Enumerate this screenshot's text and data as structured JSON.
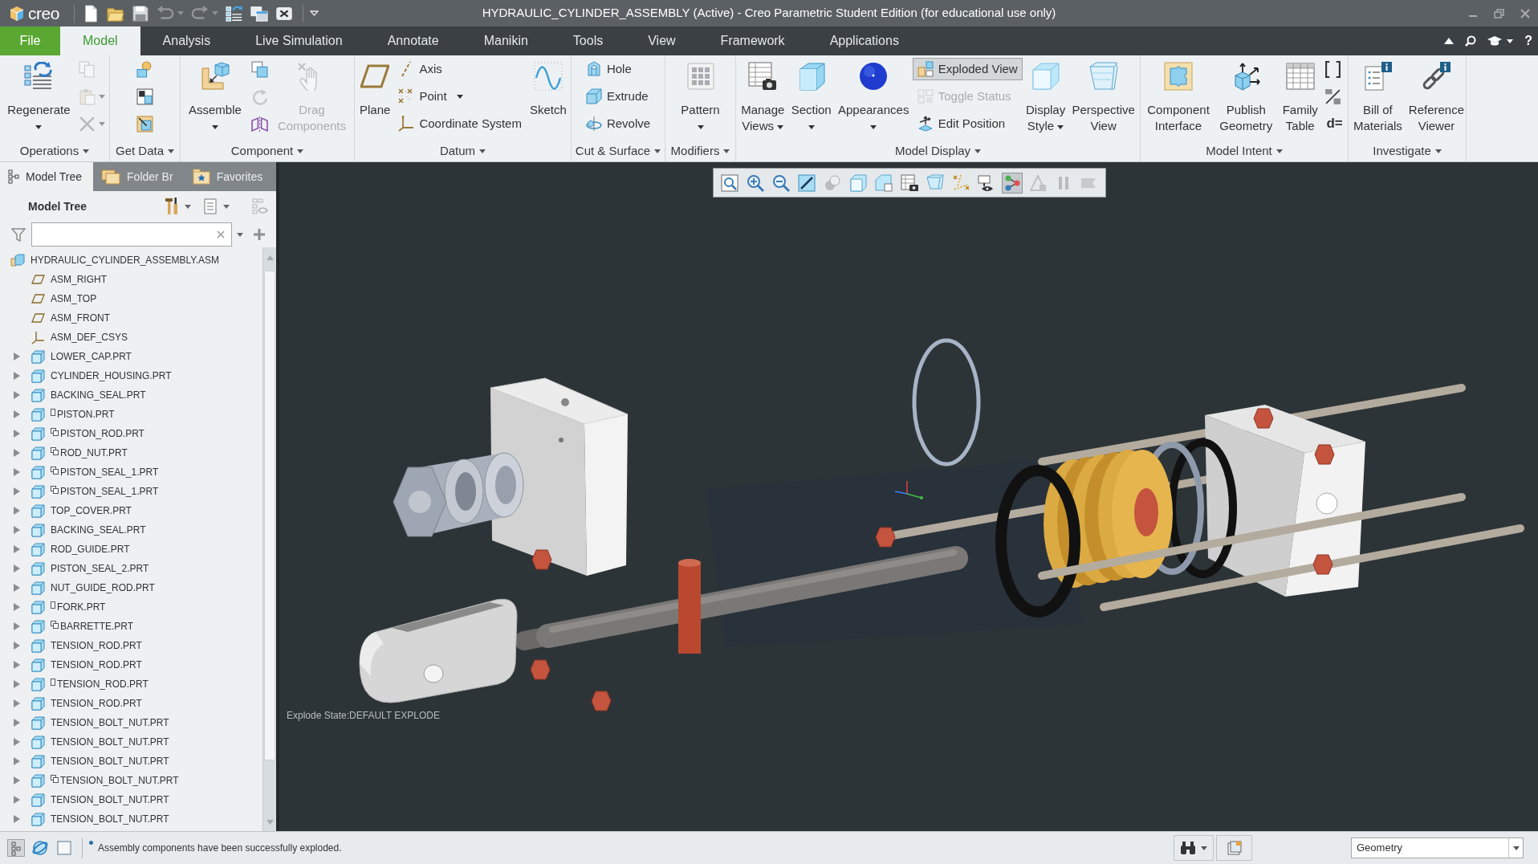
{
  "title_bar": {
    "logo": "creo",
    "quick_access": [
      {
        "disabled": false,
        "menu": false
      },
      {
        "disabled": false,
        "menu": false
      },
      {
        "disabled": false,
        "menu": false
      },
      {
        "disabled": true,
        "menu": true
      },
      {
        "disabled": true,
        "menu": true
      },
      {
        "disabled": false,
        "menu": false
      },
      {
        "disabled": false,
        "menu": false
      },
      {
        "disabled": false,
        "menu": false
      }
    ],
    "title": "HYDRAULIC_CYLINDER_ASSEMBLY (Active) - Creo Parametric Student Edition (for educational use only)"
  },
  "tab_bar": {
    "tabs": [
      {
        "label": "File",
        "kind": "file",
        "selected": false
      },
      {
        "label": "Model",
        "kind": "tab",
        "selected": true
      },
      {
        "label": "Analysis",
        "kind": "tab",
        "selected": false
      },
      {
        "label": "Live Simulation",
        "kind": "tab",
        "selected": false
      },
      {
        "label": "Annotate",
        "kind": "tab",
        "selected": false
      },
      {
        "label": "Manikin",
        "kind": "tab",
        "selected": false
      },
      {
        "label": "Tools",
        "kind": "tab",
        "selected": false
      },
      {
        "label": "View",
        "kind": "tab",
        "selected": false
      },
      {
        "label": "Framework",
        "kind": "tab",
        "selected": false
      },
      {
        "label": "Applications",
        "kind": "tab",
        "selected": false
      }
    ],
    "help": "?"
  },
  "ribbon": {
    "groups": [
      {
        "label": "Operations",
        "menu": true,
        "items": [
          {
            "kind": "large",
            "label": "Regenerate",
            "menu": true,
            "disabled": false,
            "selected": false
          },
          {
            "kind": "icon",
            "menu": false,
            "disabled": true,
            "selected": false
          },
          {
            "kind": "icon",
            "menu": true,
            "disabled": true,
            "selected": false
          },
          {
            "kind": "icon",
            "menu": true,
            "disabled": true,
            "selected": false
          }
        ]
      },
      {
        "label": "Get Data",
        "menu": true,
        "items": [
          {
            "kind": "icon",
            "menu": false,
            "disabled": false,
            "selected": false
          },
          {
            "kind": "icon",
            "menu": false,
            "disabled": false,
            "selected": false
          },
          {
            "kind": "icon",
            "menu": false,
            "disabled": false,
            "selected": false
          }
        ]
      },
      {
        "label": "Component",
        "menu": true,
        "items": [
          {
            "kind": "large",
            "label": "Assemble",
            "menu": true,
            "disabled": false,
            "selected": false
          },
          {
            "kind": "icon",
            "menu": false,
            "disabled": false,
            "selected": false
          },
          {
            "kind": "icon",
            "menu": false,
            "disabled": true,
            "selected": false
          },
          {
            "kind": "icon",
            "menu": false,
            "disabled": false,
            "selected": false
          },
          {
            "kind": "large",
            "label": "Drag Components",
            "menu": false,
            "disabled": true,
            "selected": false
          }
        ]
      },
      {
        "label": "Datum",
        "menu": true,
        "items": [
          {
            "kind": "large",
            "label": "Plane",
            "menu": false,
            "disabled": false,
            "selected": false
          },
          {
            "kind": "small",
            "label": "Axis",
            "menu": false,
            "disabled": false,
            "selected": false
          },
          {
            "kind": "small",
            "label": "Point",
            "menu": true,
            "disabled": false,
            "selected": false
          },
          {
            "kind": "small",
            "label": "Coordinate System",
            "menu": false,
            "disabled": false,
            "selected": false
          },
          {
            "kind": "large",
            "label": "Sketch",
            "menu": false,
            "disabled": false,
            "selected": false
          }
        ]
      },
      {
        "label": "Cut & Surface",
        "menu": true,
        "items": [
          {
            "kind": "small",
            "label": "Hole",
            "menu": false,
            "disabled": false,
            "selected": false
          },
          {
            "kind": "small",
            "label": "Extrude",
            "menu": false,
            "disabled": false,
            "selected": false
          },
          {
            "kind": "small",
            "label": "Revolve",
            "menu": false,
            "disabled": false,
            "selected": false
          }
        ]
      },
      {
        "label": "Modifiers",
        "menu": true,
        "items": [
          {
            "kind": "large",
            "label": "Pattern",
            "menu": true,
            "disabled": false,
            "selected": false
          }
        ]
      },
      {
        "label": "Model Display",
        "menu": true,
        "items": [
          {
            "kind": "large",
            "label": "Manage Views",
            "menu": true,
            "disabled": false,
            "selected": false
          },
          {
            "kind": "large",
            "label": "Section",
            "menu": true,
            "disabled": false,
            "selected": false
          },
          {
            "kind": "large",
            "label": "Appearances",
            "menu": true,
            "disabled": false,
            "selected": false
          },
          {
            "kind": "small",
            "label": "Exploded View",
            "menu": false,
            "disabled": false,
            "selected": true
          },
          {
            "kind": "small",
            "label": "Toggle Status",
            "menu": false,
            "disabled": true,
            "selected": false
          },
          {
            "kind": "small",
            "label": "Edit Position",
            "menu": false,
            "disabled": false,
            "selected": false
          },
          {
            "kind": "large",
            "label": "Display Style",
            "menu": true,
            "disabled": false,
            "selected": false
          },
          {
            "kind": "large",
            "label": "Perspective View",
            "menu": false,
            "disabled": false,
            "selected": false
          }
        ]
      },
      {
        "label": "Model Intent",
        "menu": true,
        "items": [
          {
            "kind": "large",
            "label": "Component Interface",
            "menu": false,
            "disabled": false,
            "selected": false
          },
          {
            "kind": "large",
            "label": "Publish Geometry",
            "menu": false,
            "disabled": false,
            "selected": false
          },
          {
            "kind": "large",
            "label": "Family Table",
            "menu": false,
            "disabled": false,
            "selected": false
          },
          {
            "kind": "icon",
            "menu": false,
            "disabled": false,
            "selected": false
          },
          {
            "kind": "icon",
            "menu": false,
            "disabled": false,
            "selected": false
          },
          {
            "kind": "glyph",
            "label": "d=",
            "menu": false,
            "disabled": false,
            "selected": false
          }
        ]
      },
      {
        "label": "Investigate",
        "menu": true,
        "items": [
          {
            "kind": "large",
            "label": "Bill of Materials",
            "menu": false,
            "disabled": false,
            "selected": false
          },
          {
            "kind": "large",
            "label": "Reference Viewer",
            "menu": false,
            "disabled": false,
            "selected": false
          }
        ]
      }
    ]
  },
  "left_panel": {
    "tabs": [
      {
        "label": "Model Tree",
        "selected": true
      },
      {
        "label": "Folder Br",
        "selected": false
      },
      {
        "label": "Favorites",
        "selected": false
      }
    ],
    "header": "Model Tree",
    "tree": {
      "label": "HYDRAULIC_CYLINDER_ASSEMBLY.ASM",
      "kind": "assembly",
      "children": [
        {
          "label": "ASM_RIGHT",
          "kind": "plane"
        },
        {
          "label": "ASM_TOP",
          "kind": "plane"
        },
        {
          "label": "ASM_FRONT",
          "kind": "plane"
        },
        {
          "label": "ASM_DEF_CSYS",
          "kind": "csys"
        },
        {
          "label": "LOWER_CAP.PRT",
          "kind": "part",
          "expanded": false
        },
        {
          "label": "CYLINDER_HOUSING.PRT",
          "kind": "part",
          "expanded": false
        },
        {
          "label": "BACKING_SEAL.PRT",
          "kind": "part",
          "expanded": false
        },
        {
          "label": "PISTON.PRT",
          "kind": "part",
          "expanded": false,
          "badge": {
            "kind": "box"
          }
        },
        {
          "label": "PISTON_ROD.PRT",
          "kind": "part",
          "expanded": false,
          "badge": {
            "kind": "stack"
          }
        },
        {
          "label": "ROD_NUT.PRT",
          "kind": "part",
          "expanded": false,
          "badge": {
            "kind": "stack"
          }
        },
        {
          "label": "PISTON_SEAL_1.PRT",
          "kind": "part",
          "expanded": false,
          "badge": {
            "kind": "stack"
          }
        },
        {
          "label": "PISTON_SEAL_1.PRT",
          "kind": "part",
          "expanded": false,
          "badge": {
            "kind": "stack"
          }
        },
        {
          "label": "TOP_COVER.PRT",
          "kind": "part",
          "expanded": false
        },
        {
          "label": "BACKING_SEAL.PRT",
          "kind": "part",
          "expanded": false
        },
        {
          "label": "ROD_GUIDE.PRT",
          "kind": "part",
          "expanded": false
        },
        {
          "label": "PISTON_SEAL_2.PRT",
          "kind": "part",
          "expanded": false
        },
        {
          "label": "NUT_GUIDE_ROD.PRT",
          "kind": "part",
          "expanded": false
        },
        {
          "label": "FORK.PRT",
          "kind": "part",
          "expanded": false,
          "badge": {
            "kind": "box"
          }
        },
        {
          "label": "BARRETTE.PRT",
          "kind": "part",
          "expanded": false,
          "badge": {
            "kind": "stack"
          }
        },
        {
          "label": "TENSION_ROD.PRT",
          "kind": "part",
          "expanded": false
        },
        {
          "label": "TENSION_ROD.PRT",
          "kind": "part",
          "expanded": false
        },
        {
          "label": "TENSION_ROD.PRT",
          "kind": "part",
          "expanded": false,
          "badge": {
            "kind": "box"
          }
        },
        {
          "label": "TENSION_ROD.PRT",
          "kind": "part",
          "expanded": false
        },
        {
          "label": "TENSION_BOLT_NUT.PRT",
          "kind": "part",
          "expanded": false
        },
        {
          "label": "TENSION_BOLT_NUT.PRT",
          "kind": "part",
          "expanded": false
        },
        {
          "label": "TENSION_BOLT_NUT.PRT",
          "kind": "part",
          "expanded": false
        },
        {
          "label": "TENSION_BOLT_NUT.PRT",
          "kind": "part",
          "expanded": false,
          "badge": {
            "kind": "stack"
          }
        },
        {
          "label": "TENSION_BOLT_NUT.PRT",
          "kind": "part",
          "expanded": false
        },
        {
          "label": "TENSION_BOLT_NUT.PRT",
          "kind": "part",
          "expanded": false
        }
      ]
    }
  },
  "viewport": {
    "toolbar": [
      {
        "selected": false,
        "disabled": false
      },
      {
        "selected": false,
        "disabled": false
      },
      {
        "selected": false,
        "disabled": false
      },
      {
        "selected": false,
        "disabled": false
      },
      {
        "selected": false,
        "disabled": false
      },
      {
        "selected": false,
        "disabled": false
      },
      {
        "selected": false,
        "disabled": false
      },
      {
        "selected": false,
        "disabled": false
      },
      {
        "selected": false,
        "disabled": false
      },
      {
        "selected": false,
        "disabled": false
      },
      {
        "selected": false,
        "disabled": false
      },
      {
        "selected": true,
        "disabled": false
      },
      {
        "selected": false,
        "disabled": true
      },
      {
        "selected": false,
        "disabled": true
      },
      {
        "selected": false,
        "disabled": true
      }
    ],
    "explode_state": "Explode State:DEFAULT EXPLODE"
  },
  "status_bar": {
    "toggles": [
      {
        "selected": true
      },
      {
        "selected": false
      },
      {
        "selected": false
      }
    ],
    "message": "Assembly components have been successfully exploded.",
    "filter": "Geometry"
  }
}
